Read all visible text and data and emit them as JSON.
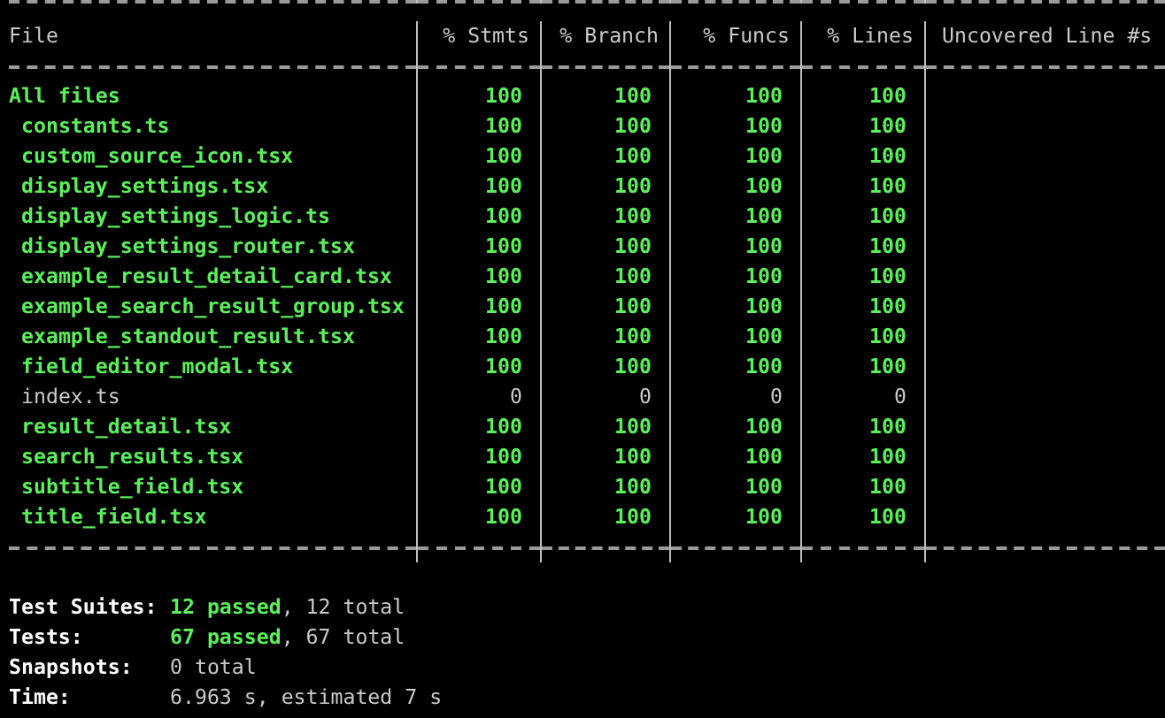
{
  "table": {
    "columns": [
      "File",
      "% Stmts",
      "% Branch",
      "% Funcs",
      "% Lines",
      "Uncovered Line #s"
    ],
    "rows": [
      {
        "file": "All files",
        "covered": true,
        "stmts": "100",
        "branch": "100",
        "funcs": "100",
        "lines": "100",
        "children": [
          {
            "file": "constants.ts",
            "covered": true,
            "stmts": "100",
            "branch": "100",
            "funcs": "100",
            "lines": "100"
          },
          {
            "file": "custom_source_icon.tsx",
            "covered": true,
            "stmts": "100",
            "branch": "100",
            "funcs": "100",
            "lines": "100"
          },
          {
            "file": "display_settings.tsx",
            "covered": true,
            "stmts": "100",
            "branch": "100",
            "funcs": "100",
            "lines": "100"
          },
          {
            "file": "display_settings_logic.ts",
            "covered": true,
            "stmts": "100",
            "branch": "100",
            "funcs": "100",
            "lines": "100"
          },
          {
            "file": "display_settings_router.tsx",
            "covered": true,
            "stmts": "100",
            "branch": "100",
            "funcs": "100",
            "lines": "100"
          },
          {
            "file": "example_result_detail_card.tsx",
            "covered": true,
            "stmts": "100",
            "branch": "100",
            "funcs": "100",
            "lines": "100"
          },
          {
            "file": "example_search_result_group.tsx",
            "covered": true,
            "stmts": "100",
            "branch": "100",
            "funcs": "100",
            "lines": "100"
          },
          {
            "file": "example_standout_result.tsx",
            "covered": true,
            "stmts": "100",
            "branch": "100",
            "funcs": "100",
            "lines": "100"
          },
          {
            "file": "field_editor_modal.tsx",
            "covered": true,
            "stmts": "100",
            "branch": "100",
            "funcs": "100",
            "lines": "100"
          },
          {
            "file": "index.ts",
            "covered": false,
            "stmts": "0",
            "branch": "0",
            "funcs": "0",
            "lines": "0"
          },
          {
            "file": "result_detail.tsx",
            "covered": true,
            "stmts": "100",
            "branch": "100",
            "funcs": "100",
            "lines": "100"
          },
          {
            "file": "search_results.tsx",
            "covered": true,
            "stmts": "100",
            "branch": "100",
            "funcs": "100",
            "lines": "100"
          },
          {
            "file": "subtitle_field.tsx",
            "covered": true,
            "stmts": "100",
            "branch": "100",
            "funcs": "100",
            "lines": "100"
          },
          {
            "file": "title_field.tsx",
            "covered": true,
            "stmts": "100",
            "branch": "100",
            "funcs": "100",
            "lines": "100"
          }
        ]
      }
    ]
  },
  "summary": [
    {
      "label": "Test Suites:",
      "passed": "12 passed",
      "rest": ", 12 total"
    },
    {
      "label": "Tests:",
      "passed": "67 passed",
      "rest": ", 67 total"
    },
    {
      "label": "Snapshots:",
      "rest": "0 total"
    },
    {
      "label": "Time:",
      "rest": "6.963 s, estimated 7 s"
    }
  ]
}
